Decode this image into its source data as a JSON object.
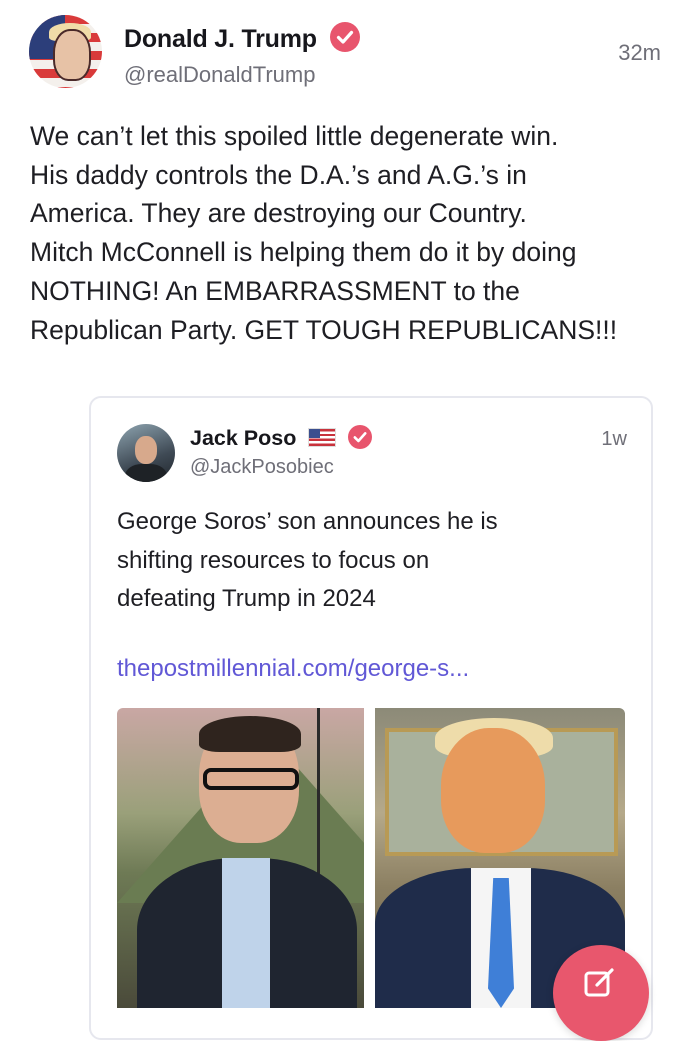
{
  "post": {
    "author_name": "Donald J. Trump",
    "handle": "@realDonaldTrump",
    "time": "32m",
    "text": "We can’t let this spoiled little degenerate win.\nHis daddy controls the D.A.’s and A.G.’s in\nAmerica. They are destroying our Country.\nMitch McConnell is helping them do it by doing\nNOTHING! An EMBARRASSMENT to the\nRepublican Party. GET TOUGH REPUBLICANS!!!"
  },
  "quote": {
    "author_name": "Jack Poso",
    "handle": "@JackPosobiec",
    "time": "1w",
    "text": "George Soros’ son announces he is\nshifting resources to focus on\ndefeating Trump in 2024",
    "link": "thepostmillennial.com/george-s..."
  },
  "icons": {
    "verified": "verified-badge-icon",
    "flag": "us-flag-icon",
    "compose": "compose-icon"
  },
  "colors": {
    "accent": "#e8556d",
    "link": "#6158d6",
    "secondary_text": "#6f6f78"
  }
}
